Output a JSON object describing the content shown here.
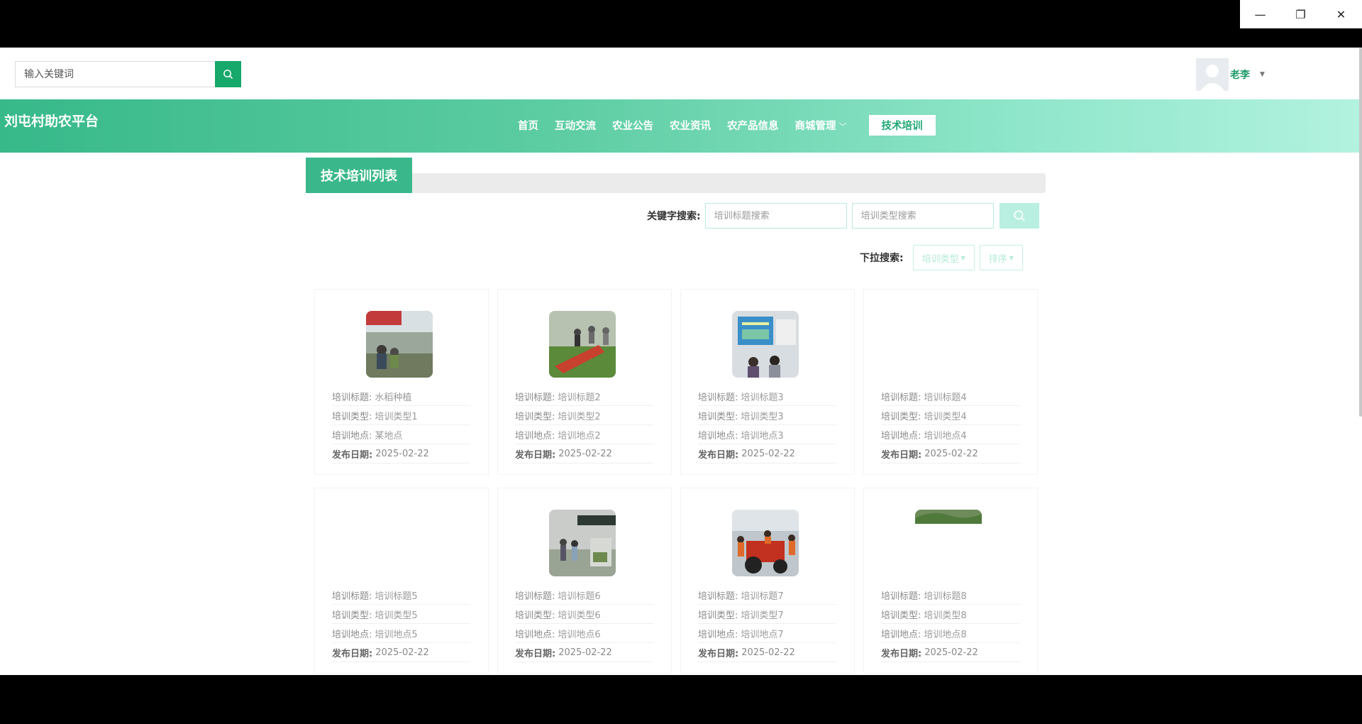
{
  "window": {
    "minimize": "—",
    "restore": "❐",
    "close": "✕"
  },
  "top_search": {
    "placeholder": "输入关键词"
  },
  "user": {
    "name": "老李"
  },
  "brand": "刘屯村助农平台",
  "nav": {
    "items": [
      "首页",
      "互动交流",
      "农业公告",
      "农业资讯",
      "农产品信息",
      "商城管理"
    ],
    "active": "技术培训"
  },
  "section_title": "技术培训列表",
  "search": {
    "label": "关键字搜索:",
    "title_placeholder": "培训标题搜索",
    "type_placeholder": "培训类型搜索"
  },
  "dropdown": {
    "label": "下拉搜索:",
    "type": "培训类型",
    "sort": "排序"
  },
  "field_labels": {
    "title": "培训标题:",
    "type": "培训类型:",
    "place": "培训地点:",
    "date": "发布日期:"
  },
  "cards": [
    {
      "title": "水稻种植",
      "type": "培训类型1",
      "place": "某地点",
      "date": "2025-02-22",
      "image": "field-workers"
    },
    {
      "title": "培训标题2",
      "type": "培训类型2",
      "place": "培训地点2",
      "date": "2025-02-22",
      "image": "machine-demo"
    },
    {
      "title": "培训标题3",
      "type": "培训类型3",
      "place": "培训地点3",
      "date": "2025-02-22",
      "image": "classroom"
    },
    {
      "title": "培训标题4",
      "type": "培训类型4",
      "place": "培训地点4",
      "date": "2025-02-22",
      "image": "blank"
    },
    {
      "title": "培训标题5",
      "type": "培训类型5",
      "place": "培训地点5",
      "date": "2025-02-22",
      "image": "blank"
    },
    {
      "title": "培训标题6",
      "type": "培训类型6",
      "place": "培训地点6",
      "date": "2025-02-22",
      "image": "tent-crowd"
    },
    {
      "title": "培训标题7",
      "type": "培训类型7",
      "place": "培训地点7",
      "date": "2025-02-22",
      "image": "tractor-group"
    },
    {
      "title": "培训标题8",
      "type": "培训类型8",
      "place": "培训地点8",
      "date": "2025-02-22",
      "image": "hills"
    }
  ],
  "colors": {
    "brand_green": "#17a86b",
    "header_start": "#37b98a",
    "header_end": "#b2f2df"
  }
}
